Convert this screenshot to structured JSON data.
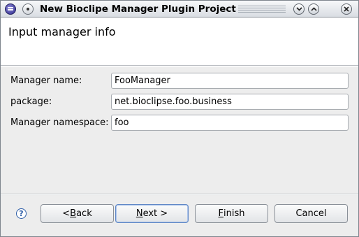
{
  "window": {
    "title": "New Bioclipe Manager Plugin Project",
    "buttons": {
      "minimize_icon": "chevron-down-icon",
      "maximize_icon": "chevron-up-icon",
      "close_icon": "close-icon"
    }
  },
  "banner": {
    "title": "Input manager info"
  },
  "form": {
    "manager_name": {
      "label": "Manager name:",
      "value": "FooManager"
    },
    "package": {
      "label": "package:",
      "value": "net.bioclipse.foo.business"
    },
    "namespace": {
      "label": "Manager namespace:",
      "value": "foo"
    }
  },
  "buttons": {
    "back": {
      "mnemonic": "B",
      "pre": "< ",
      "rest": "ack"
    },
    "next": {
      "mnemonic": "N",
      "pre": "",
      "rest": "ext >"
    },
    "finish": {
      "mnemonic": "F",
      "pre": "",
      "rest": "inish"
    },
    "cancel": {
      "label": "Cancel"
    },
    "help_glyph": "?"
  },
  "colors": {
    "title_bar": "#e4e7eb",
    "dialog_background": "#ededed",
    "banner_background": "#ffffff",
    "focus_border": "#5f87c6"
  }
}
